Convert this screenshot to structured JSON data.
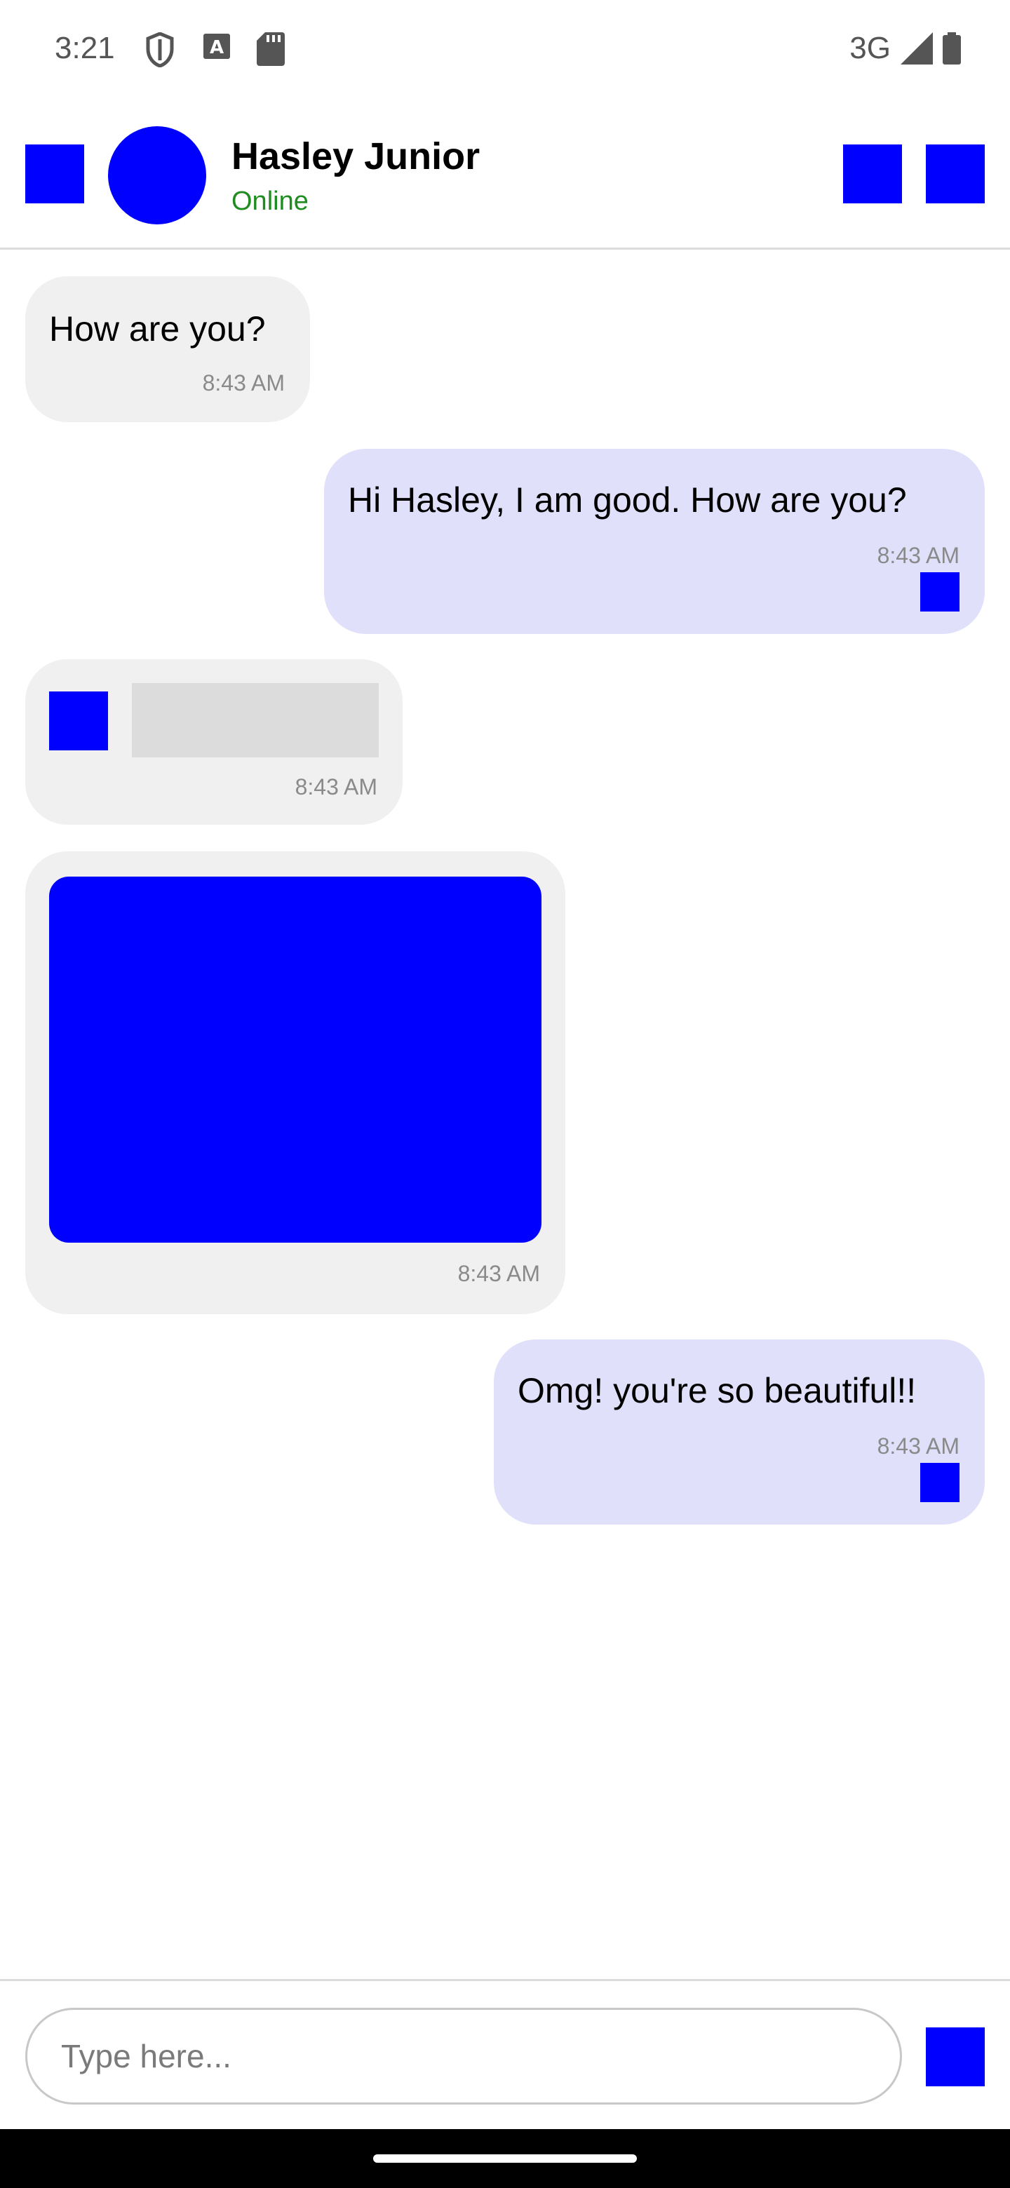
{
  "status_bar": {
    "time": "3:21",
    "network": "3G",
    "icons": [
      "shield-icon",
      "a-badge-icon",
      "sd-card-icon",
      "signal-icon",
      "battery-icon"
    ]
  },
  "header": {
    "contact_name": "Hasley Junior",
    "contact_status": "Online",
    "status_color": "#1f8c1f",
    "icons": [
      "back-arrow-icon",
      "call-icon",
      "more-options-icon"
    ]
  },
  "messages": [
    {
      "direction": "incoming",
      "type": "text",
      "text": "How are you?",
      "time": "8:43 AM"
    },
    {
      "direction": "outgoing",
      "type": "text",
      "text": "Hi Hasley, I am good. How are you?",
      "time": "8:43 AM",
      "status": "read-receipt-icon"
    },
    {
      "direction": "incoming",
      "type": "audio",
      "time": "8:43 AM",
      "icon": "play-icon"
    },
    {
      "direction": "incoming",
      "type": "image",
      "time": "8:43 AM"
    },
    {
      "direction": "outgoing",
      "type": "text",
      "text": "Omg! you're so beautiful!!",
      "time": "8:43 AM",
      "status": "read-receipt-icon"
    }
  ],
  "composer": {
    "placeholder": "Type here...",
    "send_icon": "send-icon"
  },
  "colors": {
    "incoming_bubble": "#f0f0f0",
    "outgoing_bubble": "#e0e0fb",
    "icon_placeholder": "#0000ff"
  }
}
